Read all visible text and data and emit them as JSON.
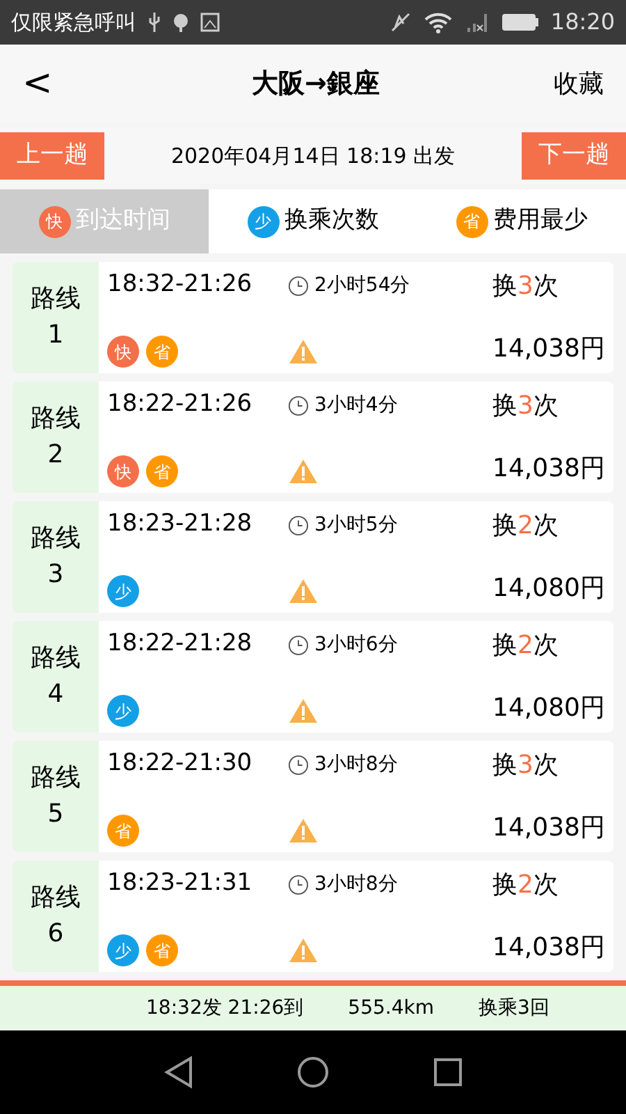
{
  "status_bar": {
    "carrier": "仅限紧急呼叫",
    "time": "18:20"
  },
  "header": {
    "back": "<",
    "title": "大阪→銀座",
    "action": "收藏"
  },
  "date_bar": {
    "prev": "上一趟",
    "date": "2020年04月14日 18:19 出发",
    "next": "下一趟"
  },
  "tabs": [
    {
      "badge": "快",
      "label": "到达时间",
      "kind": "fast",
      "selected": true
    },
    {
      "badge": "少",
      "label": "换乘次数",
      "kind": "few",
      "selected": false
    },
    {
      "badge": "省",
      "label": "费用最少",
      "kind": "cheap",
      "selected": false
    }
  ],
  "routes": [
    {
      "name": "路线",
      "number": "1",
      "time": "18:32-21:26",
      "duration": "2小时54分",
      "transfer_prefix": "换",
      "transfers": "3",
      "transfer_suffix": "次",
      "price": "14,038円",
      "tags": [
        {
          "kind": "fast",
          "label": "快"
        },
        {
          "kind": "cheap",
          "label": "省"
        }
      ]
    },
    {
      "name": "路线",
      "number": "2",
      "time": "18:22-21:26",
      "duration": "3小时4分",
      "transfer_prefix": "换",
      "transfers": "3",
      "transfer_suffix": "次",
      "price": "14,038円",
      "tags": [
        {
          "kind": "fast",
          "label": "快"
        },
        {
          "kind": "cheap",
          "label": "省"
        }
      ]
    },
    {
      "name": "路线",
      "number": "3",
      "time": "18:23-21:28",
      "duration": "3小时5分",
      "transfer_prefix": "换",
      "transfers": "2",
      "transfer_suffix": "次",
      "price": "14,080円",
      "tags": [
        {
          "kind": "few",
          "label": "少"
        }
      ]
    },
    {
      "name": "路线",
      "number": "4",
      "time": "18:22-21:28",
      "duration": "3小时6分",
      "transfer_prefix": "换",
      "transfers": "2",
      "transfer_suffix": "次",
      "price": "14,080円",
      "tags": [
        {
          "kind": "few",
          "label": "少"
        }
      ]
    },
    {
      "name": "路线",
      "number": "5",
      "time": "18:22-21:30",
      "duration": "3小时8分",
      "transfer_prefix": "换",
      "transfers": "3",
      "transfer_suffix": "次",
      "price": "14,038円",
      "tags": [
        {
          "kind": "cheap",
          "label": "省"
        }
      ]
    },
    {
      "name": "路线",
      "number": "6",
      "time": "18:23-21:31",
      "duration": "3小时8分",
      "transfer_prefix": "换",
      "transfers": "2",
      "transfer_suffix": "次",
      "price": "14,038円",
      "tags": [
        {
          "kind": "few",
          "label": "少"
        },
        {
          "kind": "cheap",
          "label": "省"
        }
      ]
    }
  ],
  "summary": {
    "times": "18:32发 21:26到",
    "distance": "555.4km",
    "transfers": "换乘3回"
  }
}
